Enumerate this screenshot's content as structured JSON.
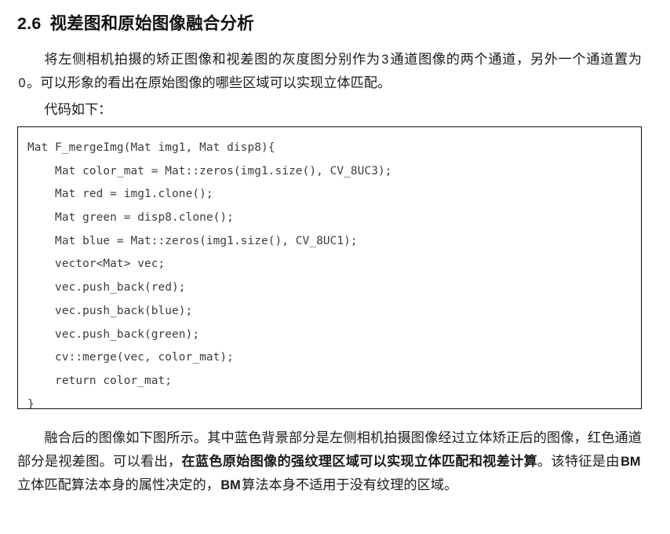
{
  "heading": {
    "number": "2.6",
    "text": "视差图和原始图像融合分析"
  },
  "paragraphs": {
    "intro_part1": "将左侧相机拍摄的矫正图像和视差图的灰度图分别作为",
    "intro_number": "3",
    "intro_part2": "通道图像的两个通道，另外一个通道置为",
    "intro_zero": "0",
    "intro_part3": "。可以形象的看出在原始图像的哪些区域可以实现立体匹配。",
    "code_lead": "代码如下：",
    "after_part1": "融合后的图像如下图所示。其中蓝色背景部分是左侧相机拍摄图像经过立体矫正后的图像，红色通道部分是视差图。可以看出，",
    "after_bold": "在蓝色原始图像的强纹理区域可以实现立体匹配和视差计算",
    "after_part2": "。该特征是由",
    "after_bm_1": "BM",
    "after_part3": "立体匹配算法本身的属性决定的，",
    "after_bm_2": "BM",
    "after_part4": "算法本身不适用于没有纹理的区域。"
  },
  "code": {
    "lines": [
      "Mat F_mergeImg(Mat img1, Mat disp8){",
      "    Mat color_mat = Mat::zeros(img1.size(), CV_8UC3);",
      "    Mat red = img1.clone();",
      "    Mat green = disp8.clone();",
      "    Mat blue = Mat::zeros(img1.size(), CV_8UC1);",
      "    vector<Mat> vec;",
      "    vec.push_back(red);",
      "    vec.push_back(blue);",
      "    vec.push_back(green);",
      "    cv::merge(vec, color_mat);",
      "    return color_mat;",
      "}"
    ]
  },
  "colors": {
    "page_background": "#ffffff",
    "body_text": "#1b1b1b",
    "heading_text": "#111111",
    "code_text": "#3b3b3b",
    "code_border": "#121212"
  }
}
